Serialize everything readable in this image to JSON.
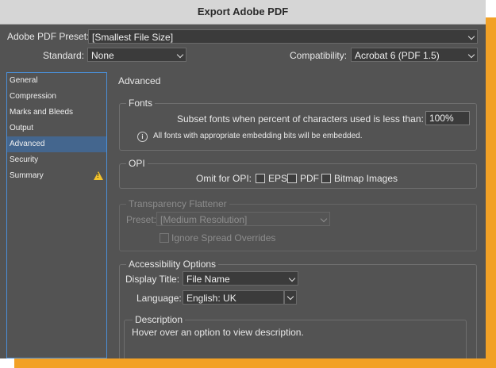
{
  "window": {
    "title": "Export Adobe PDF"
  },
  "preset": {
    "label": "Adobe PDF Preset:",
    "value": "[Smallest File Size]"
  },
  "standard": {
    "label": "Standard:",
    "value": "None"
  },
  "compatibility": {
    "label": "Compatibility:",
    "value": "Acrobat 6 (PDF 1.5)"
  },
  "sidebar": {
    "items": [
      {
        "label": "General"
      },
      {
        "label": "Compression"
      },
      {
        "label": "Marks and Bleeds"
      },
      {
        "label": "Output"
      },
      {
        "label": "Advanced",
        "selected": true
      },
      {
        "label": "Security"
      },
      {
        "label": "Summary",
        "warning_icon": "warning-icon"
      }
    ]
  },
  "panel": {
    "title": "Advanced"
  },
  "fonts": {
    "legend": "Fonts",
    "subset_label": "Subset fonts when percent of characters used is less than:",
    "subset_value": "100%",
    "info_glyph": "i",
    "info_text": "All fonts with appropriate embedding bits will be embedded."
  },
  "opi": {
    "legend": "OPI",
    "omit_label": "Omit for OPI:",
    "eps": "EPS",
    "pdf": "PDF",
    "bitmap": "Bitmap Images"
  },
  "transparency": {
    "legend": "Transparency Flattener",
    "preset_label": "Preset:",
    "preset_value": "[Medium Resolution]",
    "ignore_label": "Ignore Spread Overrides"
  },
  "accessibility": {
    "legend": "Accessibility Options",
    "display_title_label": "Display Title:",
    "display_title_value": "File Name",
    "language_label": "Language:",
    "language_value": "English: UK"
  },
  "description": {
    "legend": "Description",
    "text": "Hover over an option to view description."
  },
  "colors": {
    "accent": "#44668e",
    "frame": "#f2a126",
    "dialog_bg": "#535353",
    "warning": "#f3c32c"
  }
}
